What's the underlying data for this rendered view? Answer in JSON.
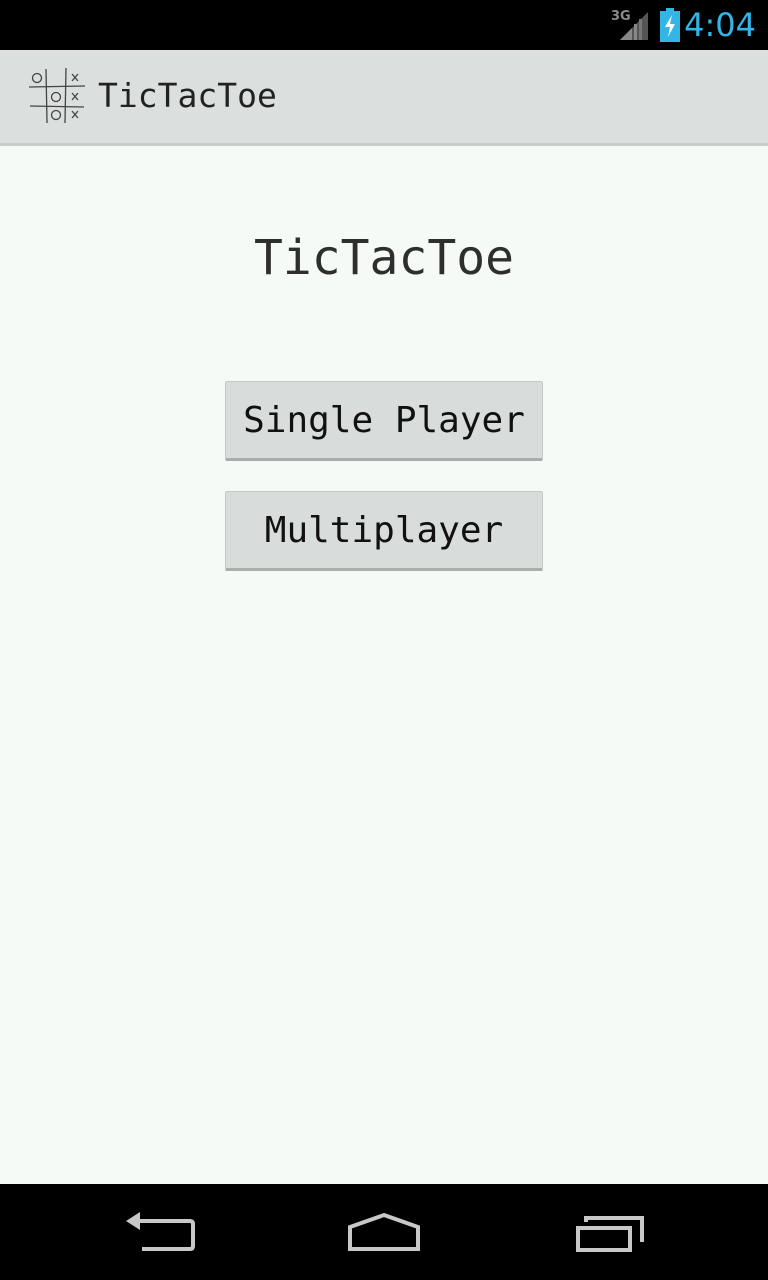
{
  "status_bar": {
    "network": "3G",
    "time": "4:04",
    "time_color": "#33b5e5"
  },
  "action_bar": {
    "title": "TicTacToe",
    "icon": "tictactoe-board-icon"
  },
  "main": {
    "title": "TicTacToe",
    "buttons": {
      "single_player": "Single Player",
      "multiplayer": "Multiplayer"
    }
  },
  "nav_bar": {
    "back_icon": "back-arrow-icon",
    "home_icon": "home-icon",
    "recents_icon": "recent-apps-icon"
  }
}
